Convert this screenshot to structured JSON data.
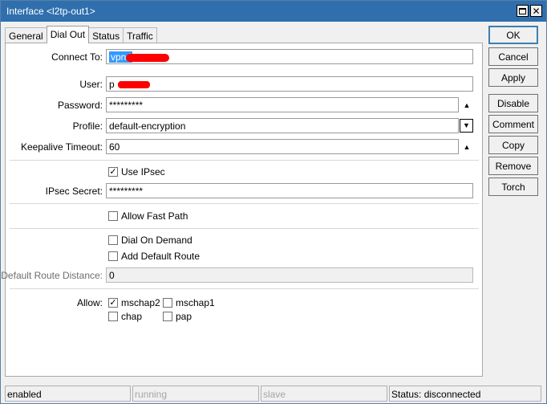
{
  "window": {
    "title": "Interface <l2tp-out1>"
  },
  "tabs": [
    {
      "label": "General",
      "active": false
    },
    {
      "label": "Dial Out",
      "active": true
    },
    {
      "label": "Status",
      "active": false
    },
    {
      "label": "Traffic",
      "active": false
    }
  ],
  "form": {
    "connect_to": {
      "label": "Connect To:",
      "value": "vpn.l"
    },
    "user": {
      "label": "User:",
      "value": "p"
    },
    "password": {
      "label": "Password:",
      "value": "*********"
    },
    "profile": {
      "label": "Profile:",
      "value": "default-encryption"
    },
    "keepalive_timeout": {
      "label": "Keepalive Timeout:",
      "value": "60"
    },
    "use_ipsec": {
      "label": "Use IPsec",
      "checked": true
    },
    "ipsec_secret": {
      "label": "IPsec Secret:",
      "value": "*********"
    },
    "allow_fast_path": {
      "label": "Allow Fast Path",
      "checked": false
    },
    "dial_on_demand": {
      "label": "Dial On Demand",
      "checked": false
    },
    "add_default_route": {
      "label": "Add Default Route",
      "checked": false
    },
    "default_route_distance": {
      "label": "Default Route Distance:",
      "value": "0"
    },
    "allow": {
      "label": "Allow:",
      "mschap2": {
        "label": "mschap2",
        "checked": true
      },
      "mschap1": {
        "label": "mschap1",
        "checked": false
      },
      "chap": {
        "label": "chap",
        "checked": false
      },
      "pap": {
        "label": "pap",
        "checked": false
      }
    }
  },
  "buttons": {
    "ok": "OK",
    "cancel": "Cancel",
    "apply": "Apply",
    "disable": "Disable",
    "comment": "Comment",
    "copy": "Copy",
    "remove": "Remove",
    "torch": "Torch"
  },
  "statusbar": {
    "state": "enabled",
    "running": "running",
    "slave": "slave",
    "status": "Status: disconnected"
  },
  "icons": {
    "check": "✓",
    "up_arrow": "▲",
    "down_arrow": "▼",
    "close": "✕"
  },
  "colors": {
    "titlebar": "#2f6fae",
    "selection": "#3399ff",
    "redaction": "#ff0000"
  }
}
